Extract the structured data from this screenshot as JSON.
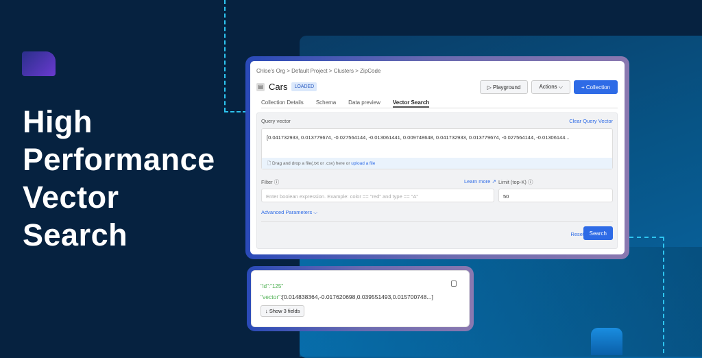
{
  "headline": [
    "High",
    "Performance",
    "Vector",
    "Search"
  ],
  "breadcrumb": "Chloe's Org > Default Project > Clusters > ZipCode",
  "collection": {
    "name": "Cars",
    "status": "LOADED"
  },
  "buttons": {
    "playground": "▷ Playground",
    "actions": "Actions ⌵",
    "add_collection": "+ Collection"
  },
  "tabs": [
    {
      "label": "Collection Details"
    },
    {
      "label": "Schema"
    },
    {
      "label": "Data preview"
    },
    {
      "label": "Vector Search",
      "active": true
    }
  ],
  "query": {
    "label": "Query vector",
    "clear": "Clear Query Vector",
    "value": "[0.041732933, 0.013779674, -0.027564144, -0.013061441, 0.009748648, 0.041732933, 0.013779674, -0.027564144, -0.01306144...",
    "drop_text": "Drag and drop a file(.txt or .csv) here or",
    "upload": "upload a file"
  },
  "filter": {
    "label": "Filter",
    "learn_more": "Learn more",
    "placeholder": "Enter boolean expression. Example: color ==  \"red\" and type == \"A\""
  },
  "limit": {
    "label": "Limit (top-K)",
    "value": "50"
  },
  "advanced": "Advanced Parameters ⌵",
  "reset": "Reset",
  "search": "Search",
  "result": {
    "id_key": "\"id\"",
    "id_val": ":\"125\"",
    "vector_key": "\"vector\"",
    "vector_val": ":[0.014838364,-0.017620698,0.039551493,0.015700748...]",
    "show_fields": "↓ Show 3 fields"
  },
  "colors": {
    "accent": "#2e6be6",
    "background": "#062240",
    "json_key": "#4caf50"
  }
}
